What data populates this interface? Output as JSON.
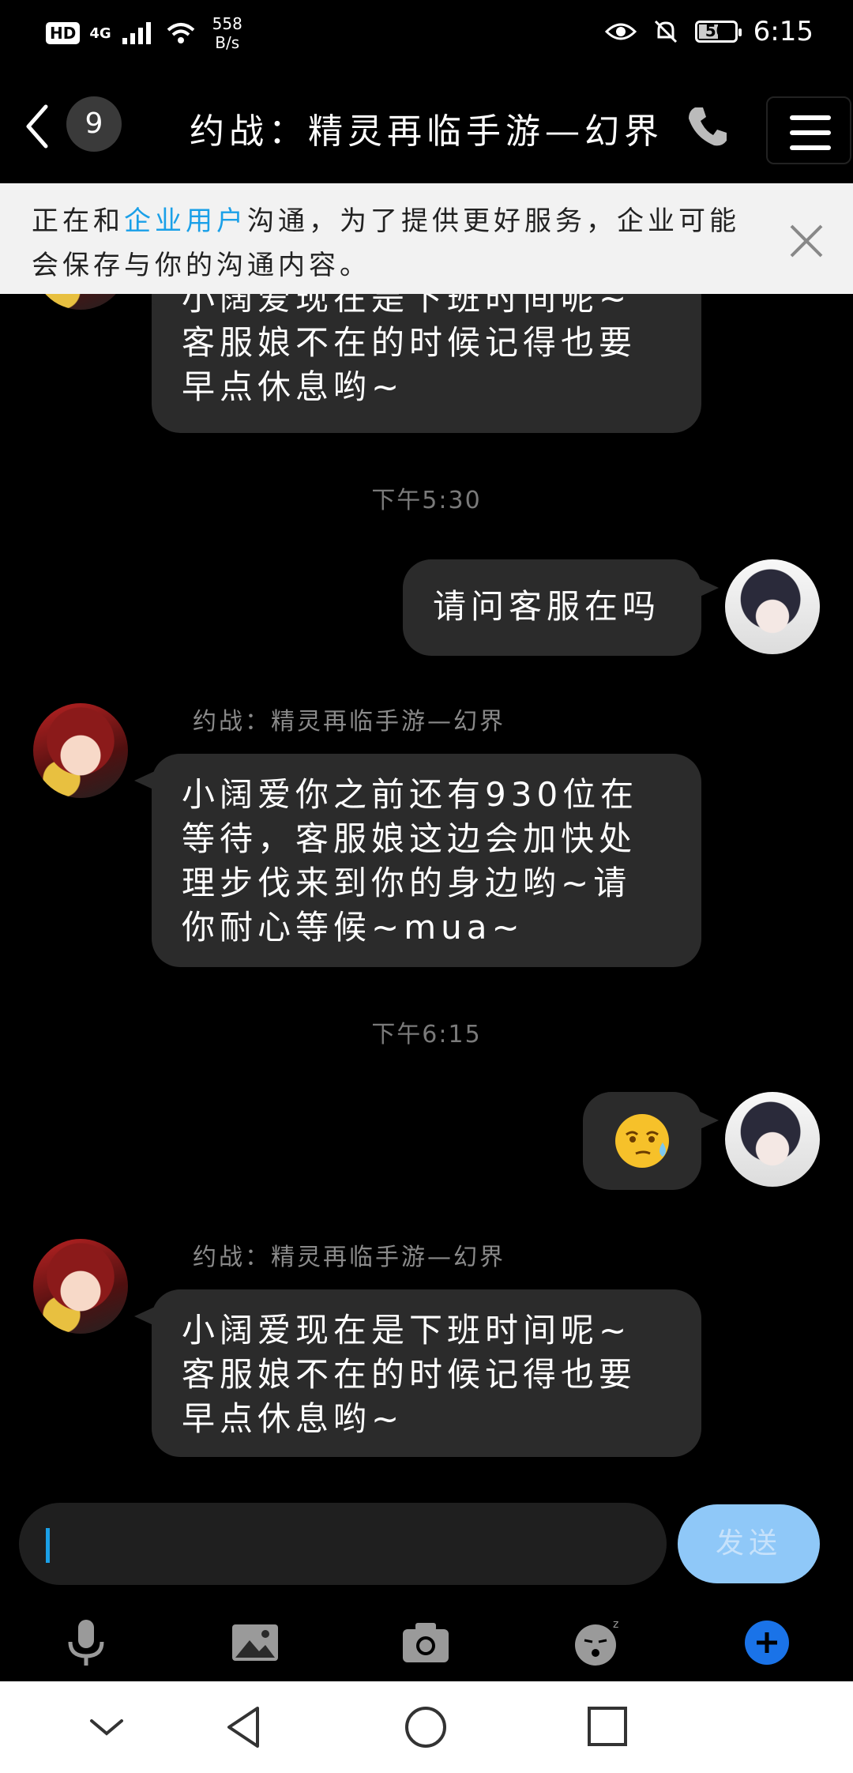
{
  "status": {
    "hd": "HD",
    "net": "4G",
    "speed_value": "558",
    "speed_unit": "B/s",
    "battery": "50",
    "time": "6:15"
  },
  "header": {
    "unread": "9",
    "title": "约战：精灵再临手游—幻界"
  },
  "notice": {
    "pre": "正在和",
    "highlight": "企业用户",
    "post": "沟通，为了提供更好服务，企业可能会保存与你的沟通内容。"
  },
  "messages": {
    "m0": "小阔爱现在是下班时间呢~\n客服娘不在的时候记得也要\n早点休息哟~",
    "t1": "下午5:30",
    "m1": "请问客服在吗",
    "sender1": "约战：精灵再临手游—幻界",
    "m2": "小阔爱你之前还有930位在\n等待，客服娘这边会加快处\n理步伐来到你的身边哟~请\n你耐心等候~mua~",
    "t2": "下午6:15",
    "sender2": "约战：精灵再临手游—幻界",
    "m3": "小阔爱现在是下班时间呢~\n客服娘不在的时候记得也要\n早点休息哟~"
  },
  "input": {
    "send": "发送"
  },
  "colors": {
    "accent": "#1aa0e8",
    "bubble": "#2b2b2b",
    "send_button": "#8fc8f8"
  }
}
